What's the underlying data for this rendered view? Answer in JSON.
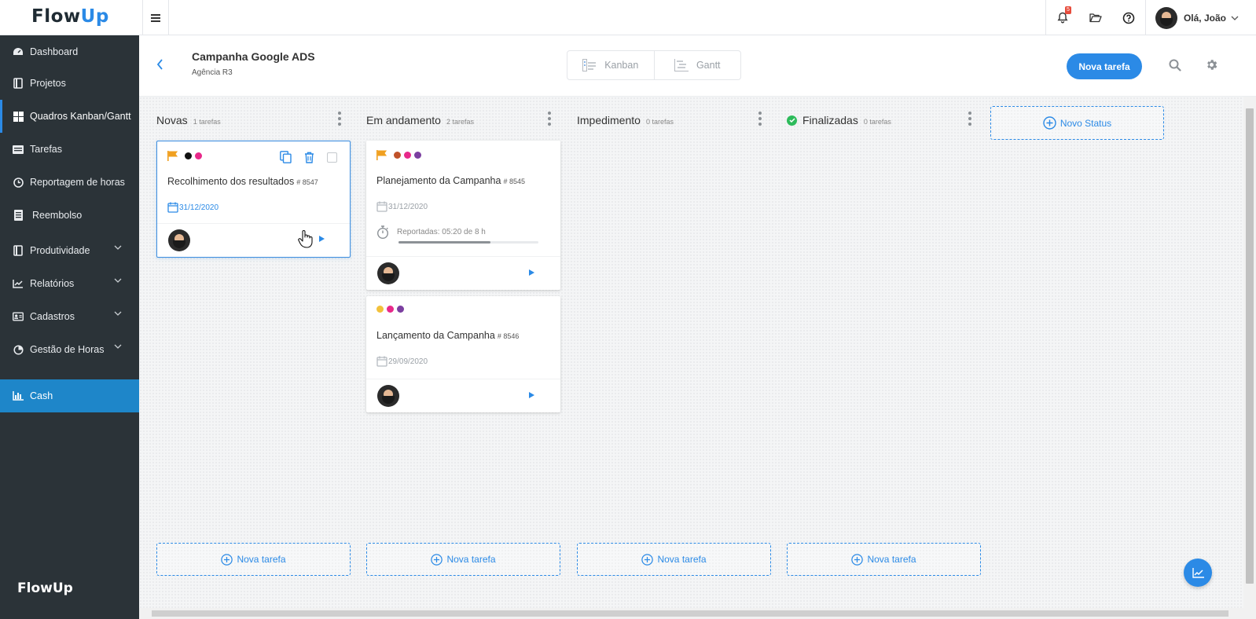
{
  "brand": {
    "logo_flow": "Flow",
    "logo_up": "Up",
    "footer_logo": "FlowUp"
  },
  "topbar": {
    "notification_count": "5",
    "user_greeting": "Olá, João"
  },
  "sidebar": {
    "items": [
      {
        "label": "Dashboard",
        "icon": "dashboard-icon"
      },
      {
        "label": "Projetos",
        "icon": "projects-icon"
      },
      {
        "label": "Quadros Kanban/Gantt",
        "icon": "kanban-icon"
      },
      {
        "label": "Tarefas",
        "icon": "tasks-icon"
      },
      {
        "label": "Reportagem de horas",
        "icon": "clock-icon"
      },
      {
        "label": "Reembolso",
        "icon": "receipt-icon"
      },
      {
        "label": "Produtividade",
        "icon": "productivity-icon"
      },
      {
        "label": "Relatórios",
        "icon": "chart-line-icon"
      },
      {
        "label": "Cadastros",
        "icon": "id-card-icon"
      },
      {
        "label": "Gestão de Horas",
        "icon": "timer-icon"
      },
      {
        "label": "Cash",
        "icon": "bar-chart-icon"
      }
    ]
  },
  "header": {
    "project_title": "Campanha Google ADS",
    "project_client": "Agência R3",
    "view_kanban": "Kanban",
    "view_gantt": "Gantt",
    "new_task_button": "Nova tarefa"
  },
  "board": {
    "new_status_label": "Novo Status",
    "add_task_label": "Nova tarefa",
    "columns": [
      {
        "title": "Novas",
        "count": "1 tarefas"
      },
      {
        "title": "Em andamento",
        "count": "2 tarefas"
      },
      {
        "title": "Impedimento",
        "count": "0 tarefas"
      },
      {
        "title": "Finalizadas",
        "count": "0 tarefas"
      }
    ],
    "cards": [
      {
        "title": "Recolhimento dos resultados",
        "number": "# 8547",
        "date": "31/12/2020"
      },
      {
        "title": "Planejamento da Campanha",
        "number": "# 8545",
        "date": "31/12/2020",
        "reported": "Reportadas: 05:20 de 8 h",
        "progress": 0.66
      },
      {
        "title": "Lançamento da Campanha",
        "number": "# 8546",
        "date": "29/09/2020"
      }
    ]
  },
  "colors": {
    "accent": "#2b8ae6",
    "sidebar_bg": "#2b3338",
    "flag": "#f0a020",
    "success": "#2dbb5b"
  }
}
